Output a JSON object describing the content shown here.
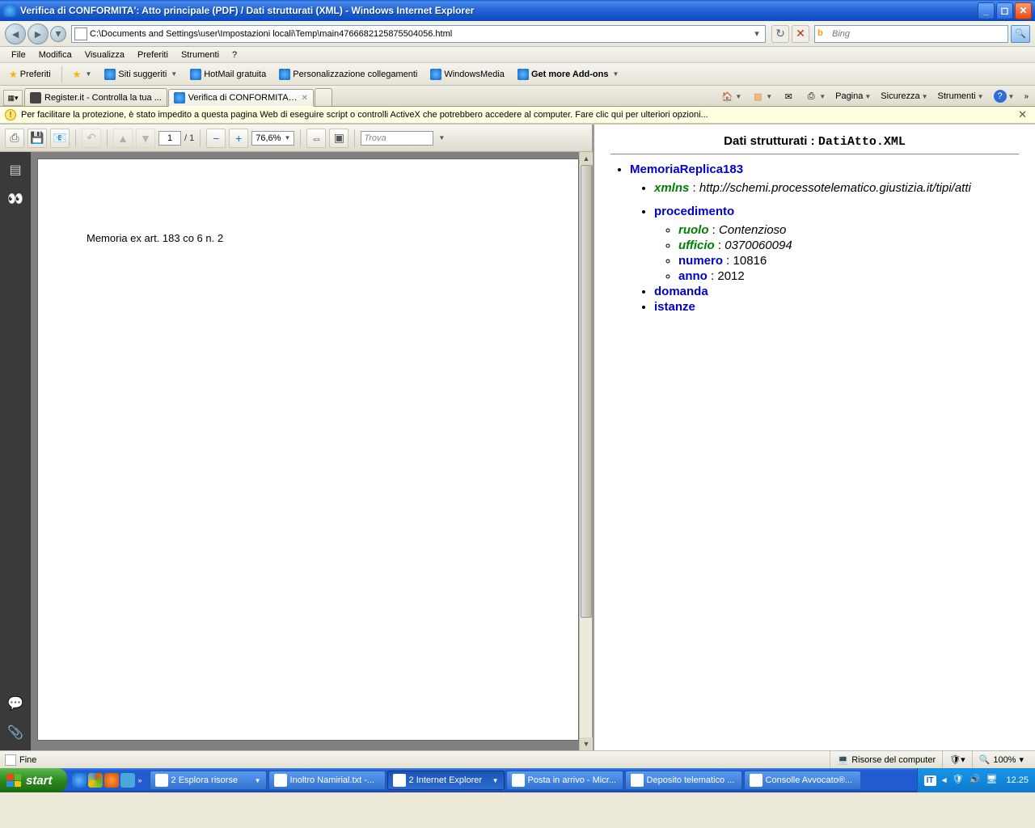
{
  "titlebar": {
    "text": "Verifica di CONFORMITA': Atto principale (PDF) / Dati strutturati (XML) - Windows Internet Explorer"
  },
  "nav": {
    "address": "C:\\Documents and Settings\\user\\Impostazioni locali\\Temp\\main4766682125875504056.html",
    "search_placeholder": "Bing"
  },
  "menubar": [
    "File",
    "Modifica",
    "Visualizza",
    "Preferiti",
    "Strumenti",
    "?"
  ],
  "favbar": {
    "preferiti": "Preferiti",
    "items": [
      "Siti suggeriti",
      "HotMail gratuita",
      "Personalizzazione collegamenti",
      "WindowsMedia",
      "Get more Add-ons"
    ]
  },
  "tabs": {
    "tab1": "Register.it - Controlla la tua ...",
    "tab2": "Verifica di CONFORMITA':..."
  },
  "cmdbar": {
    "pagina": "Pagina",
    "sicurezza": "Sicurezza",
    "strumenti": "Strumenti"
  },
  "infobar": {
    "msg": "Per facilitare la protezione, è stato impedito a questa pagina Web di eseguire script o controlli ActiveX che potrebbero accedere al computer. Fare clic qui per ulteriori opzioni..."
  },
  "pdf": {
    "page_current": "1",
    "page_total": "/  1",
    "zoom": "76,6%",
    "find_placeholder": "Trova",
    "document_text": "Memoria ex art. 183 co 6 n. 2"
  },
  "xml": {
    "heading_prefix": "Dati strutturati : ",
    "heading_file": "DatiAtto.XML",
    "root": "MemoriaReplica183",
    "xmlns_label": "xmlns",
    "xmlns_value": "http://schemi.processotelematico.giustizia.it/tipi/atti",
    "procedimento": "procedimento",
    "ruolo_label": "ruolo",
    "ruolo_value": "Contenzioso",
    "ufficio_label": "ufficio",
    "ufficio_value": "0370060094",
    "numero_label": "numero",
    "numero_value": "10816",
    "anno_label": "anno",
    "anno_value": "2012",
    "domanda": "domanda",
    "istanze": "istanze"
  },
  "statusbar": {
    "done": "Fine",
    "zone": "Risorse del computer",
    "zoom": "100%"
  },
  "taskbar": {
    "start": "start",
    "buttons": [
      {
        "label": "2 Esplora risorse",
        "grouped": true
      },
      {
        "label": "Inoltro Namirial.txt -...",
        "grouped": false
      },
      {
        "label": "2 Internet Explorer",
        "grouped": true,
        "active": true
      },
      {
        "label": "Posta in arrivo - Micr...",
        "grouped": false
      },
      {
        "label": "Deposito telematico ...",
        "grouped": false
      },
      {
        "label": "Consolle Avvocato®...",
        "grouped": false
      }
    ],
    "lang": "IT",
    "clock": "12.25"
  }
}
